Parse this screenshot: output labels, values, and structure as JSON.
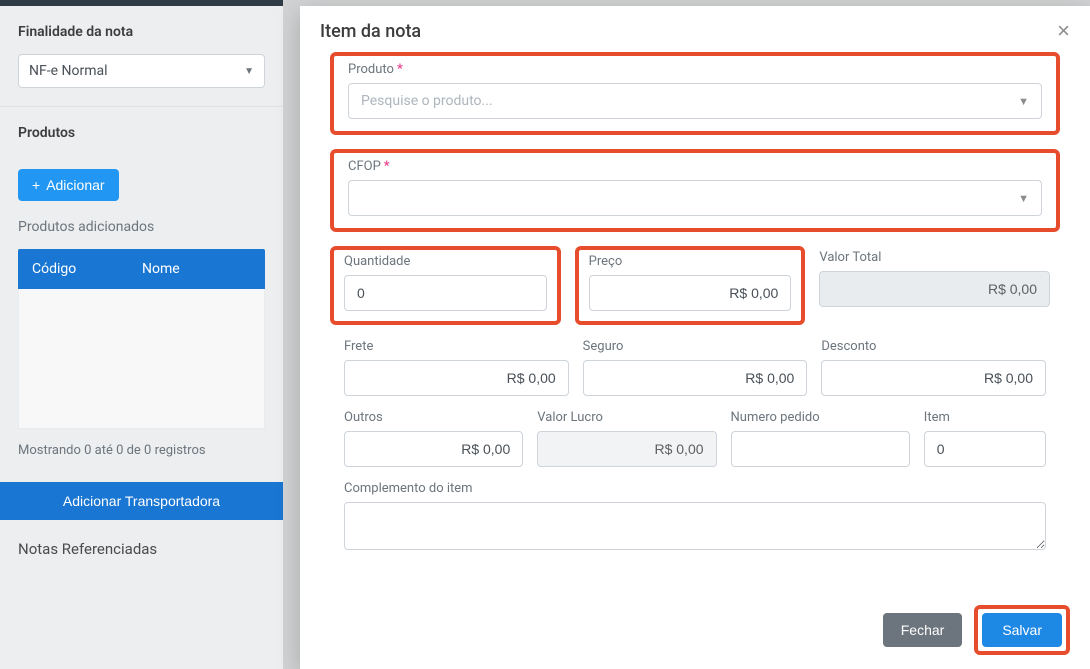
{
  "bg": {
    "top_bar_color": "#2f3b46",
    "finalidade_label": "Finalidade da nota",
    "finalidade_value": "NF-e Normal",
    "produtos_title": "Produtos",
    "add_button": "Adicionar",
    "added_label": "Produtos adicionados",
    "table": {
      "codigo": "Código",
      "nome": "Nome"
    },
    "footer_text": "Mostrando 0 até 0 de 0 registros",
    "transportadora_btn": "Adicionar Transportadora",
    "notas_ref_title": "Notas Referenciadas"
  },
  "modal": {
    "title": "Item da nota",
    "produto": {
      "label": "Produto",
      "placeholder": "Pesquise o produto..."
    },
    "cfop": {
      "label": "CFOP",
      "value": ""
    },
    "quantidade": {
      "label": "Quantidade",
      "value": "0"
    },
    "preco": {
      "label": "Preço",
      "value": "R$ 0,00"
    },
    "valor_total": {
      "label": "Valor Total",
      "value": "R$ 0,00"
    },
    "frete": {
      "label": "Frete",
      "value": "R$ 0,00"
    },
    "seguro": {
      "label": "Seguro",
      "value": "R$ 0,00"
    },
    "desconto": {
      "label": "Desconto",
      "value": "R$ 0,00"
    },
    "outros": {
      "label": "Outros",
      "value": "R$ 0,00"
    },
    "valor_lucro": {
      "label": "Valor Lucro",
      "value": "R$ 0,00"
    },
    "numero_pedido": {
      "label": "Numero pedido",
      "value": ""
    },
    "item": {
      "label": "Item",
      "value": "0"
    },
    "complemento": {
      "label": "Complemento do item",
      "value": ""
    },
    "footer": {
      "fechar": "Fechar",
      "salvar": "Salvar"
    }
  },
  "colors": {
    "highlight": "#e74c2c",
    "primary": "#1e88e5",
    "secondary": "#6c757d"
  }
}
